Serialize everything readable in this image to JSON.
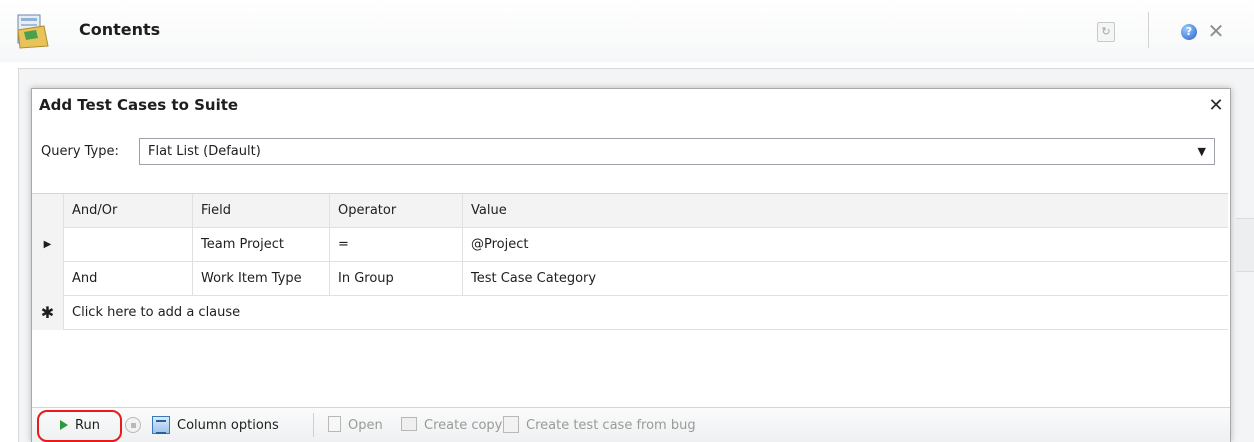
{
  "header": {
    "title": "Contents",
    "help_glyph": "?",
    "close_glyph": "✕",
    "refresh_glyph": "↻"
  },
  "dialog": {
    "title": "Add Test Cases to Suite",
    "close_glyph": "✕",
    "query_type_label": "Query Type:",
    "query_type_value": "Flat List (Default)",
    "caret_glyph": "▼"
  },
  "grid": {
    "columns": [
      "And/Or",
      "Field",
      "Operator",
      "Value"
    ],
    "rows": [
      {
        "selector": "▶",
        "and_or": "",
        "field": "Team Project",
        "operator": "=",
        "value": "@Project"
      },
      {
        "selector": "",
        "and_or": "And",
        "field": "Work Item Type",
        "operator": "In Group",
        "value": "Test Case Category"
      }
    ],
    "new_row_marker": "✱",
    "add_clause_text": "Click here to add a clause"
  },
  "toolbar": {
    "run_label": "Run",
    "column_options_label": "Column options",
    "open_label": "Open",
    "create_copy_label": "Create copy",
    "create_from_bug_label": "Create test case from bug"
  },
  "colors": {
    "run_highlight": "#e8191f",
    "run_icon": "#2f9a3c",
    "help_icon": "#2463c7"
  }
}
